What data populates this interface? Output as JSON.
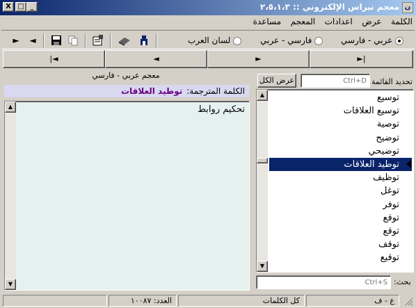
{
  "window": {
    "title": "معجم نبراس الإلكتروني :: ٢،٥،١،٣",
    "minimize": "_",
    "maximize": "□",
    "close": "X"
  },
  "menu": [
    "الكلمة",
    "عرض",
    "اعدادات",
    "المعجم",
    "مساعدة"
  ],
  "toolbar": {
    "radios": [
      {
        "label": "عربي - فارسي",
        "selected": true
      },
      {
        "label": "فارسي - عربي",
        "selected": false
      },
      {
        "label": "لسان العرب",
        "selected": false
      }
    ]
  },
  "nav": {
    "first": "|◄",
    "prev": "◄",
    "next": "►",
    "last": "►|"
  },
  "left_panel": {
    "dictionary_name": "معجم عربي - فارسي",
    "translated_label": "الكلمة المترجمة:",
    "translated_word": "توطيد العلاقات",
    "meaning": "تحكيم روابط"
  },
  "right_panel": {
    "filter_label": "تحديد القائمة",
    "filter_placeholder": "Ctrl+D",
    "show_all": "عرض الكل",
    "items": [
      "توسيع",
      "توسيع العلاقات",
      "توصية",
      "توضيح",
      "توضيحي",
      "توطيد العلاقات",
      "توظيف",
      "توغل",
      "توفر",
      "توقع",
      "توقع",
      "توقف",
      "توقيع"
    ],
    "selected_index": 5,
    "search_label": "بحث:",
    "search_placeholder": "Ctrl+S"
  },
  "status": {
    "lang": "ع - ف",
    "mode": "كل الكلمات",
    "count": "العدد: ١٠٠٨٧"
  }
}
